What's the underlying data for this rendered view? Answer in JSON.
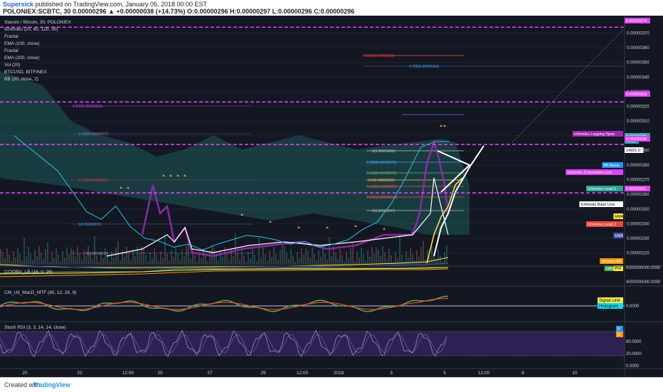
{
  "header": {
    "author": "Supersick",
    "published": "published on TradingView.com, January 05, 2018 00:00 EST",
    "ohlc": "POLONIEX:SCBTC, 30  0.00000296 ▲ +0.00000038 (+14.73%) O:0.00000296 H:0.00000297 L:0.00000296 C:0.00000296"
  },
  "legend": [
    "Siacoin / Bitcoin, 30, POLONIEX",
    "Ichimoku (20, 60, 120, 30)",
    "Fractal",
    "EMA (100, close)",
    "Fractal",
    "EMA (200, close)",
    "Vol (20)",
    "BTCUSD, BITFINEX",
    "BB (20, close, 2)"
  ],
  "price_axis": [
    "0.00000370",
    "0.00000360",
    "0.00000350",
    "0.00000340",
    "0.00000330",
    "0.00000320",
    "0.00000310",
    "0.00000300",
    "0.00000290",
    "0.00000280",
    "0.00000270",
    "0.00000260",
    "0.00000250",
    "0.00000240",
    "0.00000230",
    "0.00000220"
  ],
  "axis_tags": [
    {
      "text": "0.00000374",
      "color": "#e040fb"
    },
    {
      "text": "0.00000323",
      "color": "#e040fb"
    },
    {
      "text": "Ichimoku Lagging Span",
      "color": "#9c27b0"
    },
    {
      "text": "0.00000296",
      "color": "#26a69a"
    },
    {
      "text": "29:38",
      "color": "#26a69a"
    },
    {
      "text": "0.00000294",
      "color": "#e040fb"
    },
    {
      "text": "14931.0",
      "color": "#ffffff"
    },
    {
      "text": "BB Basis",
      "color": "#2196f3"
    },
    {
      "text": "Ichimoku Conversion Line",
      "color": "#e040fb"
    },
    {
      "text": "Ichimoku Lead 1",
      "color": "#26a69a"
    },
    {
      "text": "0.00000261",
      "color": "#e040fb"
    },
    {
      "text": "Ichimoku Base Line",
      "color": "#ffffff"
    },
    {
      "text": "EMA",
      "color": "#ffeb3b"
    },
    {
      "text": "Ichimoku Lead 2",
      "color": "#f44336"
    },
    {
      "text": "EMA",
      "color": "#3f51b5"
    },
    {
      "text": "Volume MA",
      "color": "#ff9800"
    },
    {
      "text": "OBV_CCI",
      "color": "#4caf50"
    },
    {
      "text": "PVI",
      "color": "#ffeb3b"
    }
  ],
  "fib_labels_upper": [
    "2.618(0.00000350)",
    "0.786(0.00000343)",
    "4.236(0.00000316)",
    "1.618(0.00000297)",
    "2.618(0.00000261)",
    "1(0.00000231)",
    "0(0.00000218)"
  ],
  "fib_labels_lower": [
    "1(0.00000286)",
    "0.786(0.00000279)",
    "0.618(0.00000273)",
    "0.5(0.00000269)",
    "0.382(0.00000265)",
    "0.236(0.00000261)",
    "0(0.00000247)"
  ],
  "panel2": {
    "title": "CCIOBV_LB (16, 0, 26)",
    "axis": [
      "5000000000.0000",
      "4000000000.0000"
    ]
  },
  "panel3": {
    "title": "CM_Ult_MacD_MTF (60, 12, 26, 9)",
    "axis": "0.0000",
    "tag1": "Signal Line",
    "tag2": "Histogram"
  },
  "panel4": {
    "title": "Stoch RSI (3, 3, 14, 14, close)",
    "axis": [
      "80.0000",
      "20.0000",
      "0.0000"
    ],
    "tagK": "K",
    "tagD": "D"
  },
  "time_axis": [
    "20",
    "22",
    "12:00",
    "25",
    "27",
    "29",
    "12:00",
    "2018",
    "3",
    "5",
    "12:00",
    "8",
    "10"
  ],
  "footer": {
    "created": "Created with",
    "brand": "TradingView"
  },
  "chart_data": {
    "type": "line",
    "title": "Siacoin / Bitcoin, 30, POLONIEX",
    "ylim": [
      2.13e-06,
      3.78e-06
    ],
    "series": [
      {
        "name": "Siacoin / Bitcoin",
        "y": [
          3e-06,
          2.92e-06,
          2.84e-06,
          2.76e-06,
          2.62e-06,
          2.48e-06,
          2.43e-06,
          2.52e-06,
          2.38e-06,
          2.3e-06,
          2.28e-06,
          2.24e-06,
          2.26e-06,
          2.22e-06,
          2.26e-06,
          2.29e-06,
          2.32e-06,
          2.31e-06,
          2.29e-06,
          2.26e-06,
          2.28e-06,
          2.24e-06,
          2.26e-06,
          2.29e-06,
          2.36e-06,
          2.41e-06,
          2.54e-06,
          2.72e-06,
          2.92e-06,
          2.96e-06,
          2.96e-06
        ]
      }
    ],
    "horizontal_lines": [
      3.74e-06,
      3.23e-06,
      2.94e-06,
      2.61e-06
    ]
  }
}
